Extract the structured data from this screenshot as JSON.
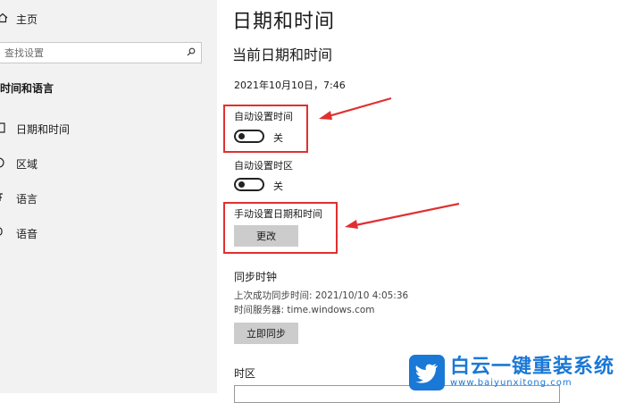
{
  "sidebar": {
    "home_label": "主页",
    "search_placeholder": "查找设置",
    "section_title": "时间和语言",
    "items": [
      {
        "label": "日期和时间",
        "icon": "calendar-icon"
      },
      {
        "label": "区域",
        "icon": "globe-icon"
      },
      {
        "label": "语言",
        "icon": "language-icon"
      },
      {
        "label": "语音",
        "icon": "microphone-icon"
      }
    ]
  },
  "main": {
    "title": "日期和时间",
    "subtitle": "当前日期和时间",
    "current_datetime": "2021年10月10日，7:46",
    "auto_time": {
      "label": "自动设置时间",
      "state": "关"
    },
    "auto_timezone": {
      "label": "自动设置时区",
      "state": "关"
    },
    "manual": {
      "label": "手动设置日期和时间",
      "button": "更改"
    },
    "sync": {
      "heading": "同步时钟",
      "last_sync": "上次成功同步时间: 2021/10/10 4:05:36",
      "server": "时间服务器: time.windows.com",
      "button": "立即同步"
    },
    "timezone": {
      "heading": "时区"
    }
  },
  "annotations": {
    "color": "#e03030"
  },
  "watermark": {
    "cn": "白云一键重装系统",
    "url": "www.baiyunxitong.com",
    "color": "#1a78d6"
  }
}
